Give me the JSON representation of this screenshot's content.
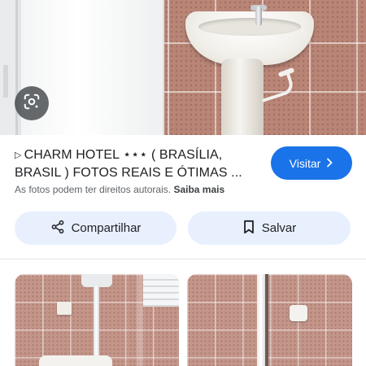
{
  "result": {
    "title": "CHARM HOTEL ⋆⋆⋆ ( BRASÍLIA, BRASIL ) FOTOS REAIS E ÓTIMAS ...",
    "title_prefix_icon": "play-triangle-icon",
    "visit_label": "Visitar",
    "copyright_notice": "As fotos podem ter direitos autorais.",
    "learn_more_label": "Saiba mais"
  },
  "actions": {
    "share_label": "Compartilhar",
    "save_label": "Salvar"
  },
  "icons": {
    "lens": "google-lens-icon",
    "visit_chevron": "chevron-right-icon",
    "share": "share-icon",
    "save": "bookmark-icon"
  },
  "colors": {
    "primary_button": "#1a73e8",
    "tonal_button": "#e8f0fe",
    "secondary_text": "#5f6368"
  }
}
